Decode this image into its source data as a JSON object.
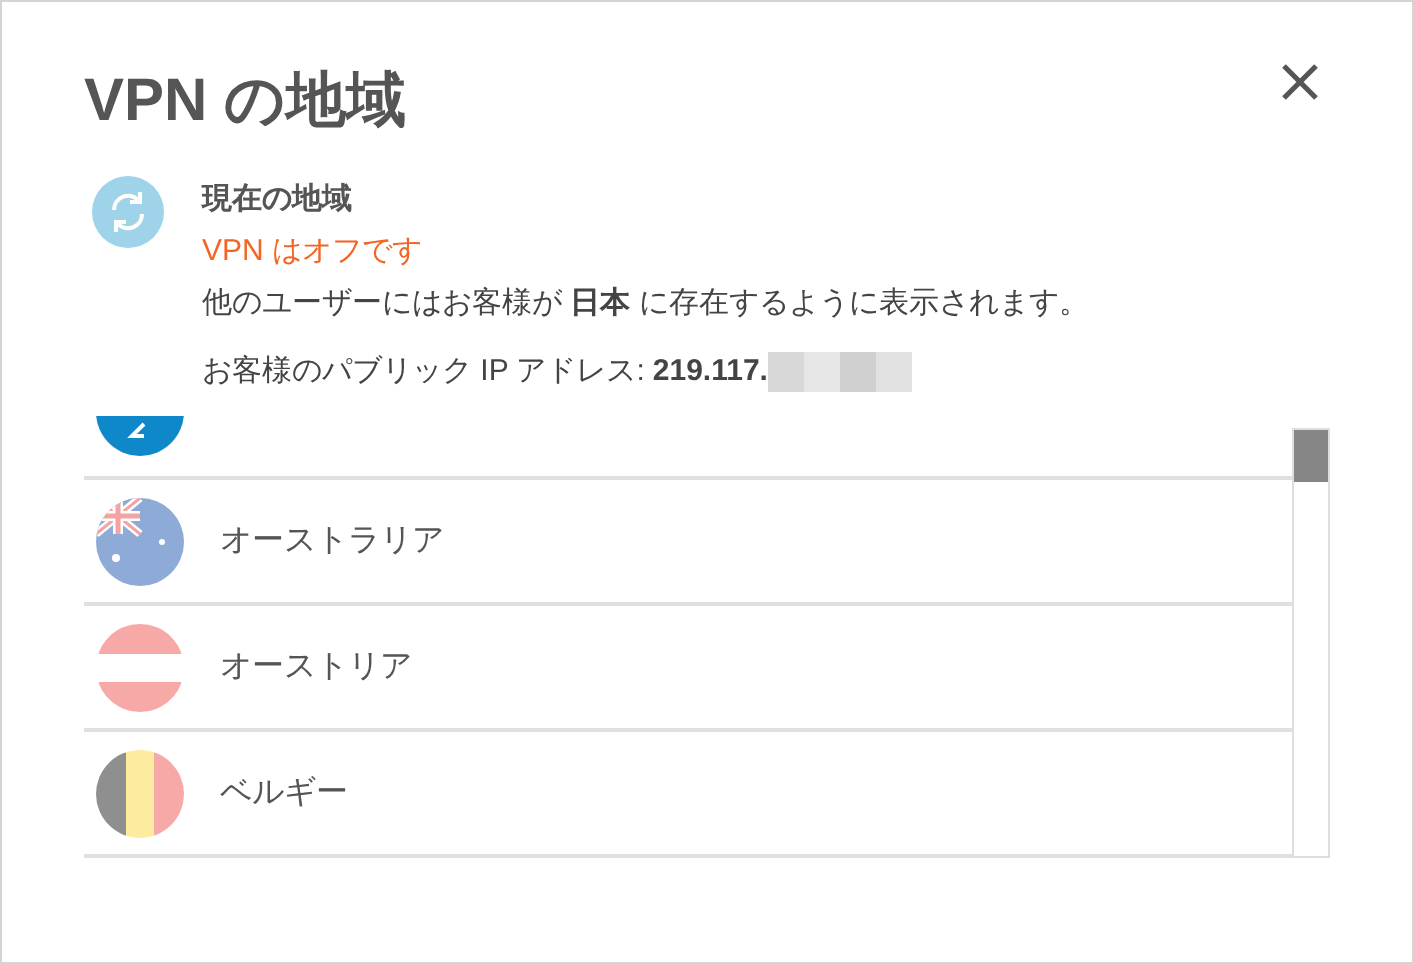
{
  "title": "VPN の地域",
  "current": {
    "heading": "現在の地域",
    "status": "VPN はオフです",
    "message": "他のユーザーにはお客様が **日本** に存在するように表示されます。",
    "ip_label": "お客様のパブリック IP アドレス:",
    "ip_value": "219.117."
  },
  "regions": [
    {
      "kind": "auto"
    },
    {
      "kind": "au",
      "name": "オーストラリア"
    },
    {
      "kind": "at",
      "name": "オーストリア"
    },
    {
      "kind": "be",
      "name": "ベルギー"
    }
  ]
}
